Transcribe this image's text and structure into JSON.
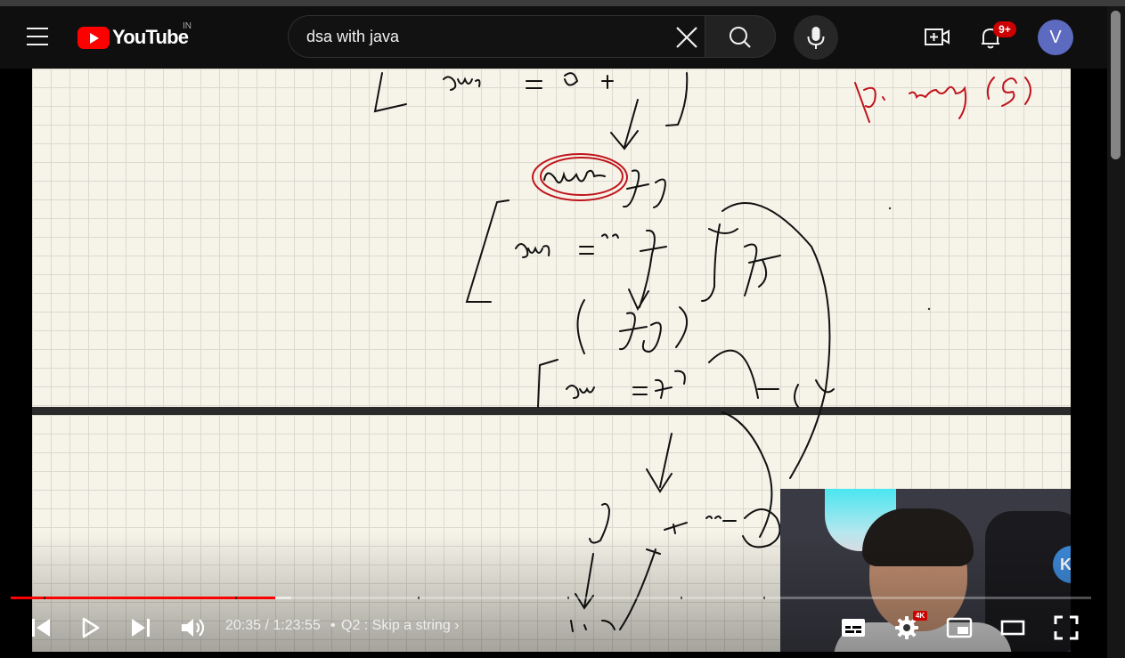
{
  "app": {
    "brand": "YouTube",
    "country_code": "IN"
  },
  "search": {
    "query": "dsa with java"
  },
  "header": {
    "notification_count": "9+",
    "avatar_letter": "V"
  },
  "player": {
    "current_time": "20:35",
    "duration": "1:23:55",
    "time_display": "20:35 / 1:23:55",
    "chapter_title": "Q2 : Skip a string",
    "progress_played": 0.245,
    "progress_loaded": 0.26,
    "quality_badge": "4K",
    "channel_badge": "KK"
  },
  "colors": {
    "brand_red": "#ff0000",
    "badge_red": "#cc0000",
    "avatar": "#5c6bc0",
    "notebook": "#f6f4e9"
  },
  "icons": [
    "menu-icon",
    "youtube-logo",
    "clear-icon",
    "search-icon",
    "mic-icon",
    "create-icon",
    "bell-icon",
    "prev-icon",
    "play-icon",
    "next-icon",
    "volume-icon",
    "subtitles-icon",
    "settings-icon",
    "miniplayer-icon",
    "theater-icon",
    "fullscreen-icon"
  ]
}
